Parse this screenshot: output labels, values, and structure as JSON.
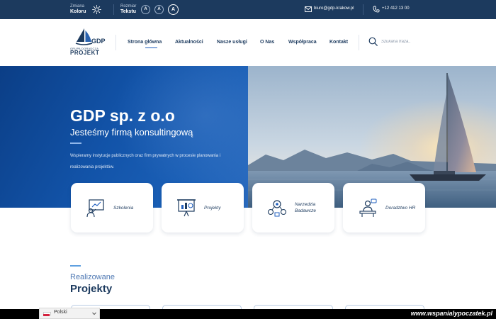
{
  "topbar": {
    "color_label_small": "Zmiana",
    "color_label_bold": "Koloru",
    "text_label_small": "Rozmiar",
    "text_label_bold": "Tekstu",
    "font_sizes": [
      "A",
      "A",
      "A"
    ],
    "email": "biuro@gdp-krakow.pl",
    "phone": "+12 412 13 00"
  },
  "logo": {
    "name": "GDP",
    "subtitle": "GRUPA DORADCZA",
    "word": "PROJEKT"
  },
  "nav": {
    "items": [
      "Strona główna",
      "Aktualności",
      "Nasze usługi",
      "O Nas",
      "Współpraca",
      "Kontakt"
    ],
    "active_index": 0
  },
  "search": {
    "placeholder": "Szukana fraza.."
  },
  "hero": {
    "title": "GDP sp. z o.o",
    "subtitle": "Jesteśmy firmą konsultingową",
    "description": "Wspieramy instytucje publicznych oraz firm prywatnych w procesie planowania i realizowania projektów."
  },
  "services": [
    {
      "label": "Szkolenia",
      "icon": "presentation-icon"
    },
    {
      "label": "Projekty",
      "icon": "chart-board-icon"
    },
    {
      "label": "Narzedzia Badawcze",
      "icon": "research-tools-icon"
    },
    {
      "label": "Doradztwo HR",
      "icon": "hr-consulting-icon"
    }
  ],
  "projects": {
    "label_small": "Realizowane",
    "label_big": "Projekty"
  },
  "language": {
    "selected": "Polski"
  },
  "watermark": "www.wspanialypoczatek.pl",
  "colors": {
    "navy": "#1c3a5e",
    "hero_blue": "#1253a8",
    "accent": "#5fa0e0"
  }
}
